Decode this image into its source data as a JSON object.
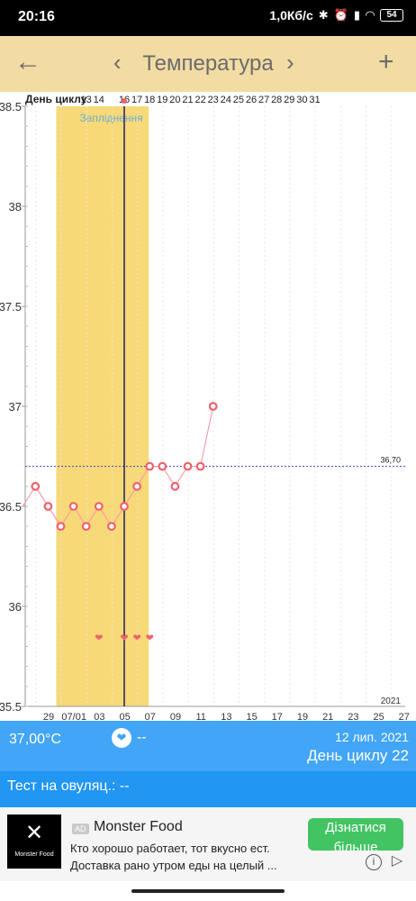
{
  "status_bar": {
    "time": "20:16",
    "network_speed": "1,0Кб/с",
    "battery": "54",
    "icons": [
      "bluetooth-icon",
      "alarm-icon",
      "signal-icon",
      "wifi-icon",
      "battery-icon"
    ]
  },
  "app_bar": {
    "title": "Температура",
    "back_icon": "←",
    "prev_icon": "‹",
    "next_icon": "›",
    "add_icon": "+"
  },
  "chart_data": {
    "type": "line",
    "title": "",
    "cycle_day_label": "День циклу",
    "cycle_days": [
      "13",
      "14",
      "",
      "16",
      "17",
      "18",
      "19",
      "20",
      "21",
      "22",
      "23",
      "24",
      "25",
      "26",
      "27",
      "28",
      "29",
      "30",
      "31"
    ],
    "fertile_label": "Запліднення",
    "y_ticks": [
      "38.5",
      "38",
      "37.5",
      "37",
      "36.5",
      "36",
      "35.5"
    ],
    "ylim": [
      35.5,
      38.5
    ],
    "x_ticks": [
      "29",
      "07/01",
      "03",
      "05",
      "07",
      "09",
      "11",
      "13",
      "15",
      "17",
      "19",
      "21",
      "23",
      "25",
      "27"
    ],
    "year": "2021",
    "coverline": {
      "value": 36.7,
      "label": "36,70"
    },
    "series": [
      {
        "x": [
          "2021-06-27",
          "2021-06-28",
          "2021-06-29",
          "2021-06-30",
          "2021-07-01",
          "2021-07-02",
          "2021-07-03",
          "2021-07-04",
          "2021-07-05",
          "2021-07-06",
          "2021-07-07",
          "2021-07-08",
          "2021-07-09",
          "2021-07-10",
          "2021-07-11",
          "2021-07-12"
        ],
        "values": [
          36.5,
          36.6,
          36.5,
          36.4,
          36.5,
          36.4,
          36.5,
          36.4,
          36.5,
          36.6,
          36.7,
          36.7,
          36.6,
          36.7,
          36.7,
          37.0
        ]
      }
    ],
    "fertile_window": [
      "2021-06-30",
      "2021-07-06"
    ],
    "ovulation_day": "2021-07-05",
    "hearts": [
      "2021-07-03",
      "2021-07-05",
      "2021-07-06",
      "2021-07-07"
    ],
    "colors": {
      "fertile": "#f8d977",
      "line": "#f4a0a8",
      "point": "#f0606d",
      "coverline": "#3344cc",
      "ovulation": "#1a1f6e",
      "grid": "#e6e6e6",
      "label": "#6ab0d8"
    }
  },
  "info_bar": {
    "temperature": "37,00°C",
    "mucus": "--",
    "date": "12 лип. 2021",
    "cycle_day": "День циклу 22"
  },
  "test_bar": {
    "text": "Тест на овуляц.: --"
  },
  "ad": {
    "badge": "AD",
    "title": "Monster Food",
    "logo_text": "Monster Food",
    "line1": "Кто хорошо работает, тот вкусно ест.",
    "line2": "Доставка рано утром еды на целый ...",
    "cta": "Дізнатися більше"
  }
}
